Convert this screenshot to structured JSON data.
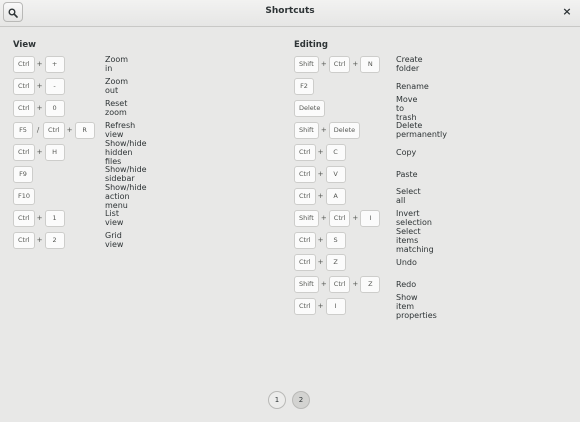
{
  "window": {
    "title": "Shortcuts"
  },
  "icons": {
    "search": "search-icon",
    "close": "close-icon"
  },
  "sections": [
    {
      "title": "View",
      "rows": [
        {
          "keys": [
            "Ctrl",
            "+",
            "+"
          ],
          "label": "Zoom in"
        },
        {
          "keys": [
            "Ctrl",
            "+",
            "-"
          ],
          "label": "Zoom out"
        },
        {
          "keys": [
            "Ctrl",
            "+",
            "0"
          ],
          "label": "Reset zoom"
        },
        {
          "keys": [
            "F5",
            "/",
            "Ctrl",
            "+",
            "R"
          ],
          "label": "Refresh view"
        },
        {
          "keys": [
            "Ctrl",
            "+",
            "H"
          ],
          "label": "Show/hide hidden files"
        },
        {
          "keys": [
            "F9"
          ],
          "label": "Show/hide sidebar"
        },
        {
          "keys": [
            "F10"
          ],
          "label": "Show/hide action menu"
        },
        {
          "keys": [
            "Ctrl",
            "+",
            "1"
          ],
          "label": "List view"
        },
        {
          "keys": [
            "Ctrl",
            "+",
            "2"
          ],
          "label": "Grid view"
        }
      ]
    },
    {
      "title": "Editing",
      "rows": [
        {
          "keys": [
            "Shift",
            "+",
            "Ctrl",
            "+",
            "N"
          ],
          "label": "Create folder"
        },
        {
          "keys": [
            "F2"
          ],
          "label": "Rename"
        },
        {
          "keys": [
            "Delete"
          ],
          "label": "Move to trash"
        },
        {
          "keys": [
            "Shift",
            "+",
            "Delete"
          ],
          "label": "Delete permanently"
        },
        {
          "keys": [
            "Ctrl",
            "+",
            "C"
          ],
          "label": "Copy"
        },
        {
          "keys": [
            "Ctrl",
            "+",
            "V"
          ],
          "label": "Paste"
        },
        {
          "keys": [
            "Ctrl",
            "+",
            "A"
          ],
          "label": "Select all"
        },
        {
          "keys": [
            "Shift",
            "+",
            "Ctrl",
            "+",
            "I"
          ],
          "label": "Invert selection"
        },
        {
          "keys": [
            "Ctrl",
            "+",
            "S"
          ],
          "label": "Select items matching"
        },
        {
          "keys": [
            "Ctrl",
            "+",
            "Z"
          ],
          "label": "Undo"
        },
        {
          "keys": [
            "Shift",
            "+",
            "Ctrl",
            "+",
            "Z"
          ],
          "label": "Redo"
        },
        {
          "keys": [
            "Ctrl",
            "+",
            "I"
          ],
          "label": "Show item properties"
        }
      ]
    }
  ],
  "pagination": {
    "pages": [
      "1",
      "2"
    ],
    "current": "2"
  }
}
